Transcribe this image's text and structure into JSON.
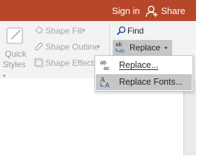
{
  "titlebar": {
    "signin_label": "Sign in",
    "share_label": "Share",
    "color": "#b7472a"
  },
  "ribbon": {
    "quick_styles": {
      "line1": "Quick",
      "line2": "Styles",
      "chevron": "▾"
    },
    "shape_fill_label": "Shape Fill",
    "shape_outline_label": "Shape Outline",
    "shape_effects_label": "Shape Effects",
    "dropdown_chevron": "▾",
    "find_label": "Find",
    "replace_label": "Replace"
  },
  "replace_menu": {
    "items": [
      {
        "label": "Replace...",
        "icon": "replace-abc-icon",
        "underline_char": "R"
      },
      {
        "label": "Replace Fonts...",
        "icon": "replace-fonts-icon",
        "underline_char": "o",
        "highlighted": true
      }
    ]
  },
  "icons": [
    "quick-styles-icon",
    "paint-bucket-icon",
    "pencil-outline-icon",
    "shape-effects-icon",
    "magnifier-icon",
    "replace-abc-icon",
    "replace-fonts-icon",
    "person-plus-icon"
  ]
}
